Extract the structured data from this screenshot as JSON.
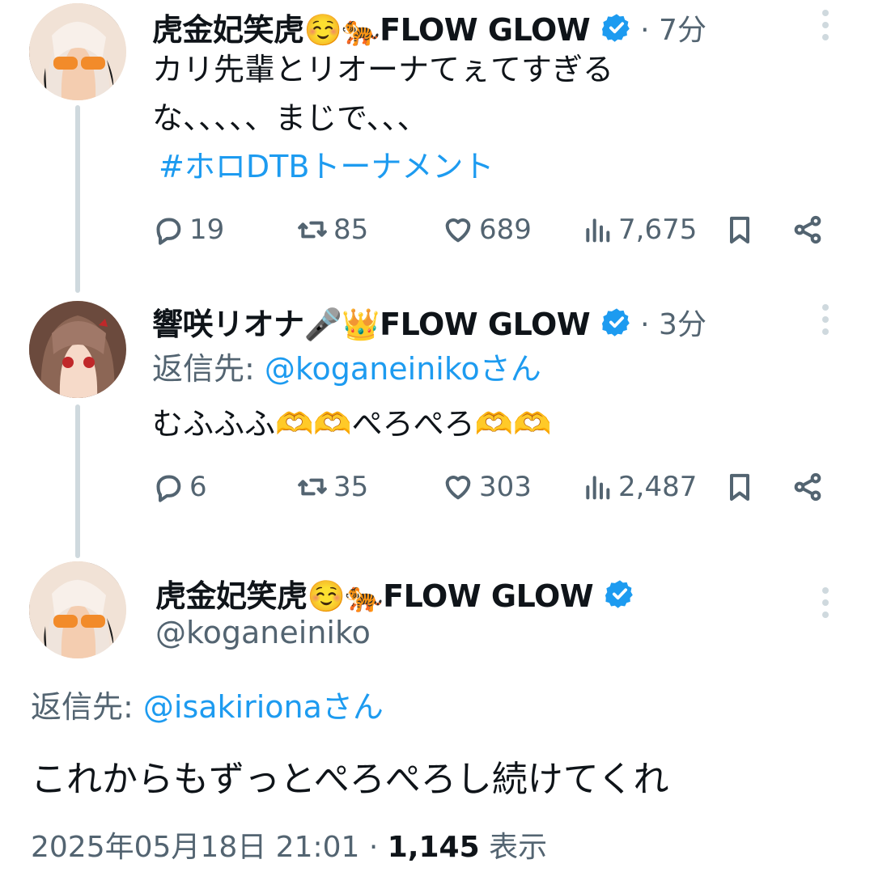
{
  "tweets": [
    {
      "display_name": "虎金妃笑虎☺️🐅FLOW GLOW",
      "time": "· 7分",
      "text_lines": [
        "カリ先輩とリオーナてぇてすぎる",
        "な、、、、、まじで、、、"
      ],
      "hashtag": "#ホロDTBトーナメント",
      "replies": "19",
      "reposts": "85",
      "likes": "689",
      "views": "7,675"
    },
    {
      "display_name": "響咲リオナ🎤👑FLOW GLOW",
      "time": "· 3分",
      "reply_prefix": "返信先: ",
      "reply_handle": "@koganeinikoさん",
      "text": "むふふふ🫶🫶ぺろぺろ🫶🫶",
      "replies": "6",
      "reposts": "35",
      "likes": "303",
      "views": "2,487"
    }
  ],
  "main_tweet": {
    "display_name": "虎金妃笑虎☺️🐅FLOW GLOW",
    "handle": "@koganeiniko",
    "reply_prefix": "返信先: ",
    "reply_handle": "@isakirionaさん",
    "text": "これからもずっとぺろぺろし続けてくれ",
    "timestamp": "2025年05月18日 21:01",
    "separator": " · ",
    "views_count": "1,145",
    "views_label": " 表示"
  },
  "icons": [
    "verified-badge-icon",
    "more-icon",
    "reply-icon",
    "repost-icon",
    "like-icon",
    "views-icon",
    "bookmark-icon",
    "share-icon"
  ],
  "colors": {
    "link": "#1d9bf0",
    "muted": "#536471",
    "badge": "#1d9bf0",
    "thread_line": "#cfd9de"
  }
}
